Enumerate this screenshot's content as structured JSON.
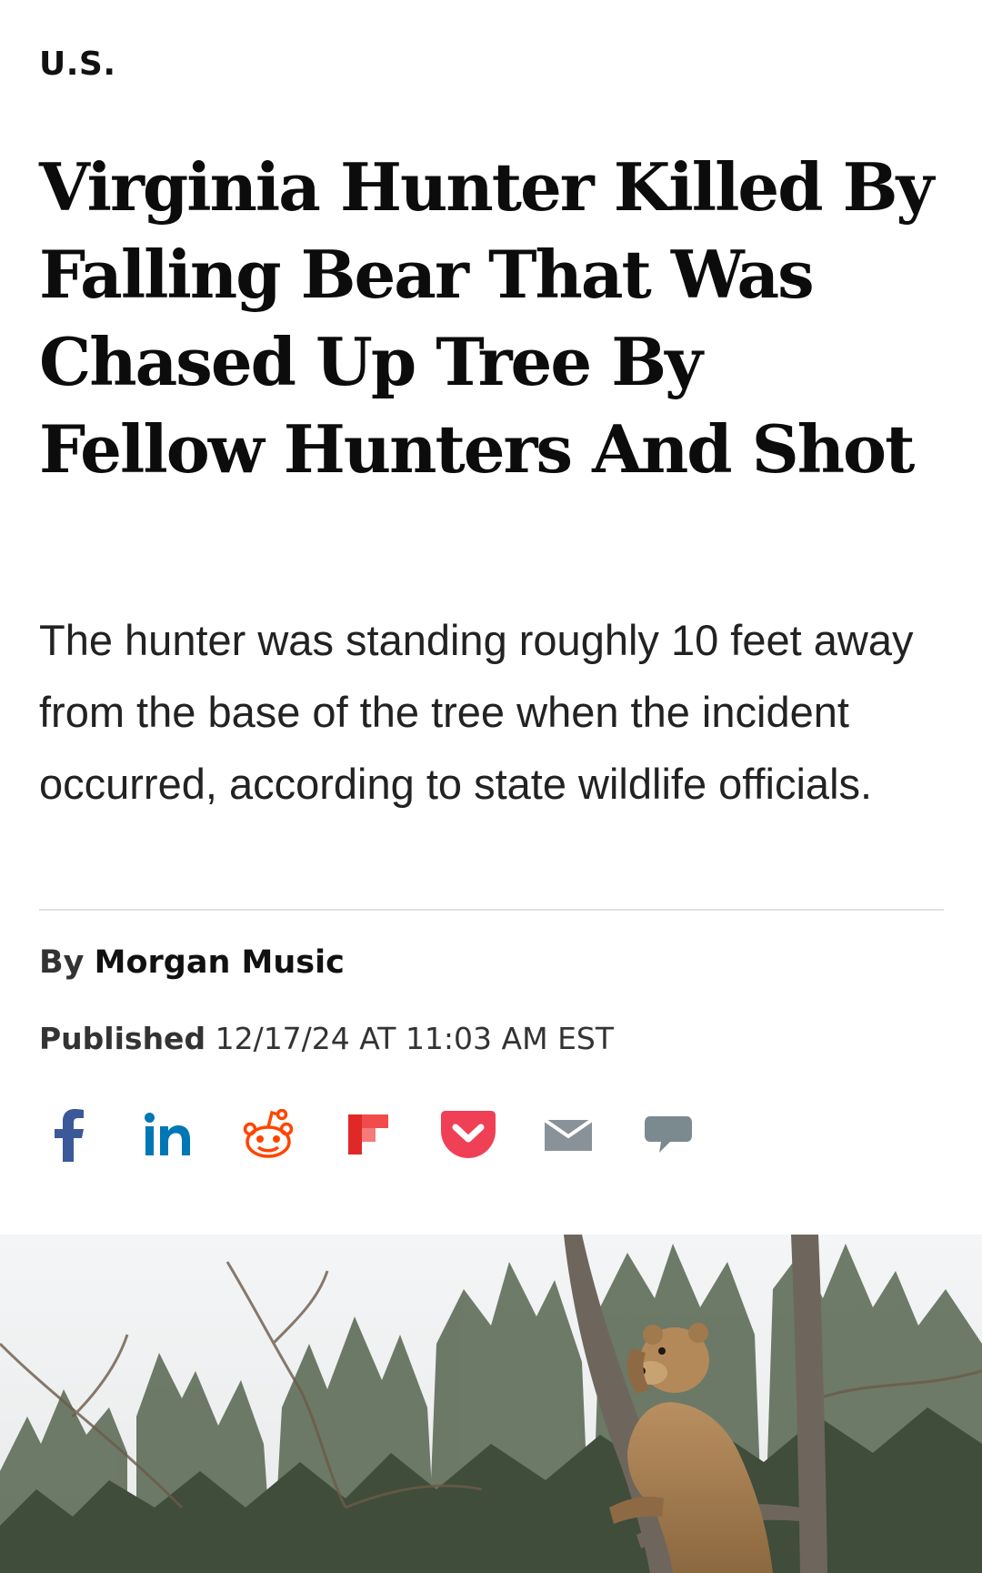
{
  "section": {
    "label": "U.S."
  },
  "article": {
    "headline": "Virginia Hunter Killed By Falling Bear That Was Chased Up Tree By Fellow Hunters And Shot",
    "dek": "The hunter was standing roughly 10 feet away from the base of the tree when the incident occurred, according to state wildlife officials.",
    "byline_prefix": "By",
    "author": "Morgan Music",
    "published_label": "Published",
    "published_value": "12/17/24 AT 11:03 AM EST"
  },
  "share": {
    "icons": [
      {
        "name": "facebook-icon",
        "color": "#3b5998"
      },
      {
        "name": "linkedin-icon",
        "color": "#0077b5"
      },
      {
        "name": "reddit-icon",
        "color": "#ff4500"
      },
      {
        "name": "flipboard-icon",
        "color": "#e12828"
      },
      {
        "name": "pocket-icon",
        "color": "#ef4056"
      },
      {
        "name": "email-icon",
        "color": "#8a9299"
      },
      {
        "name": "comment-icon",
        "color": "#7a8a8f"
      }
    ]
  },
  "hero_image": {
    "subject": "bear-climbing-tree-photo"
  }
}
